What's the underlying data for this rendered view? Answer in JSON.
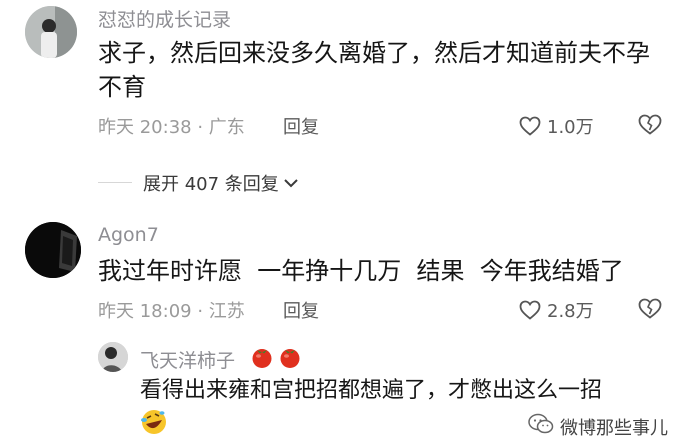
{
  "comments": [
    {
      "username": "怼怼的成长记录",
      "text_line1": "求子，然后回来没多久离婚了，然后才知道前夫不孕",
      "text_line2": "不育",
      "time_location": "昨天 20:38 · 广东",
      "reply_label": "回复",
      "likes": "1.0万",
      "avatar_icon": "avatar-girl",
      "like_icon": "heart-icon",
      "dislike_icon": "broken-heart-icon"
    },
    {
      "username": "Agon7",
      "text": "我过年时许愿  一年挣十几万  结果  今年我结婚了",
      "time_location": "昨天 18:09 · 江苏",
      "reply_label": "回复",
      "likes": "2.8万",
      "avatar_icon": "avatar-dark-doorway",
      "like_icon": "heart-icon",
      "dislike_icon": "broken-heart-icon"
    }
  ],
  "expand": {
    "label": "展开 407 条回复",
    "icon": "chevron-down-icon"
  },
  "sub_reply": {
    "username": "飞天洋柿子",
    "username_emojis": "tomato-icon tomato-icon",
    "text_line1": "看得出来雍和宫把招都想遍了，才憋出这么一招",
    "text_line2_emoji": "rolling-laughing-emoji",
    "avatar_icon": "avatar-person-bw"
  },
  "watermark": {
    "text": "微博那些事儿",
    "icon": "wechat-logo-icon"
  },
  "colors": {
    "username": "#8e8e93",
    "meta": "#9a9a9a",
    "tomato": "#e0301e"
  }
}
